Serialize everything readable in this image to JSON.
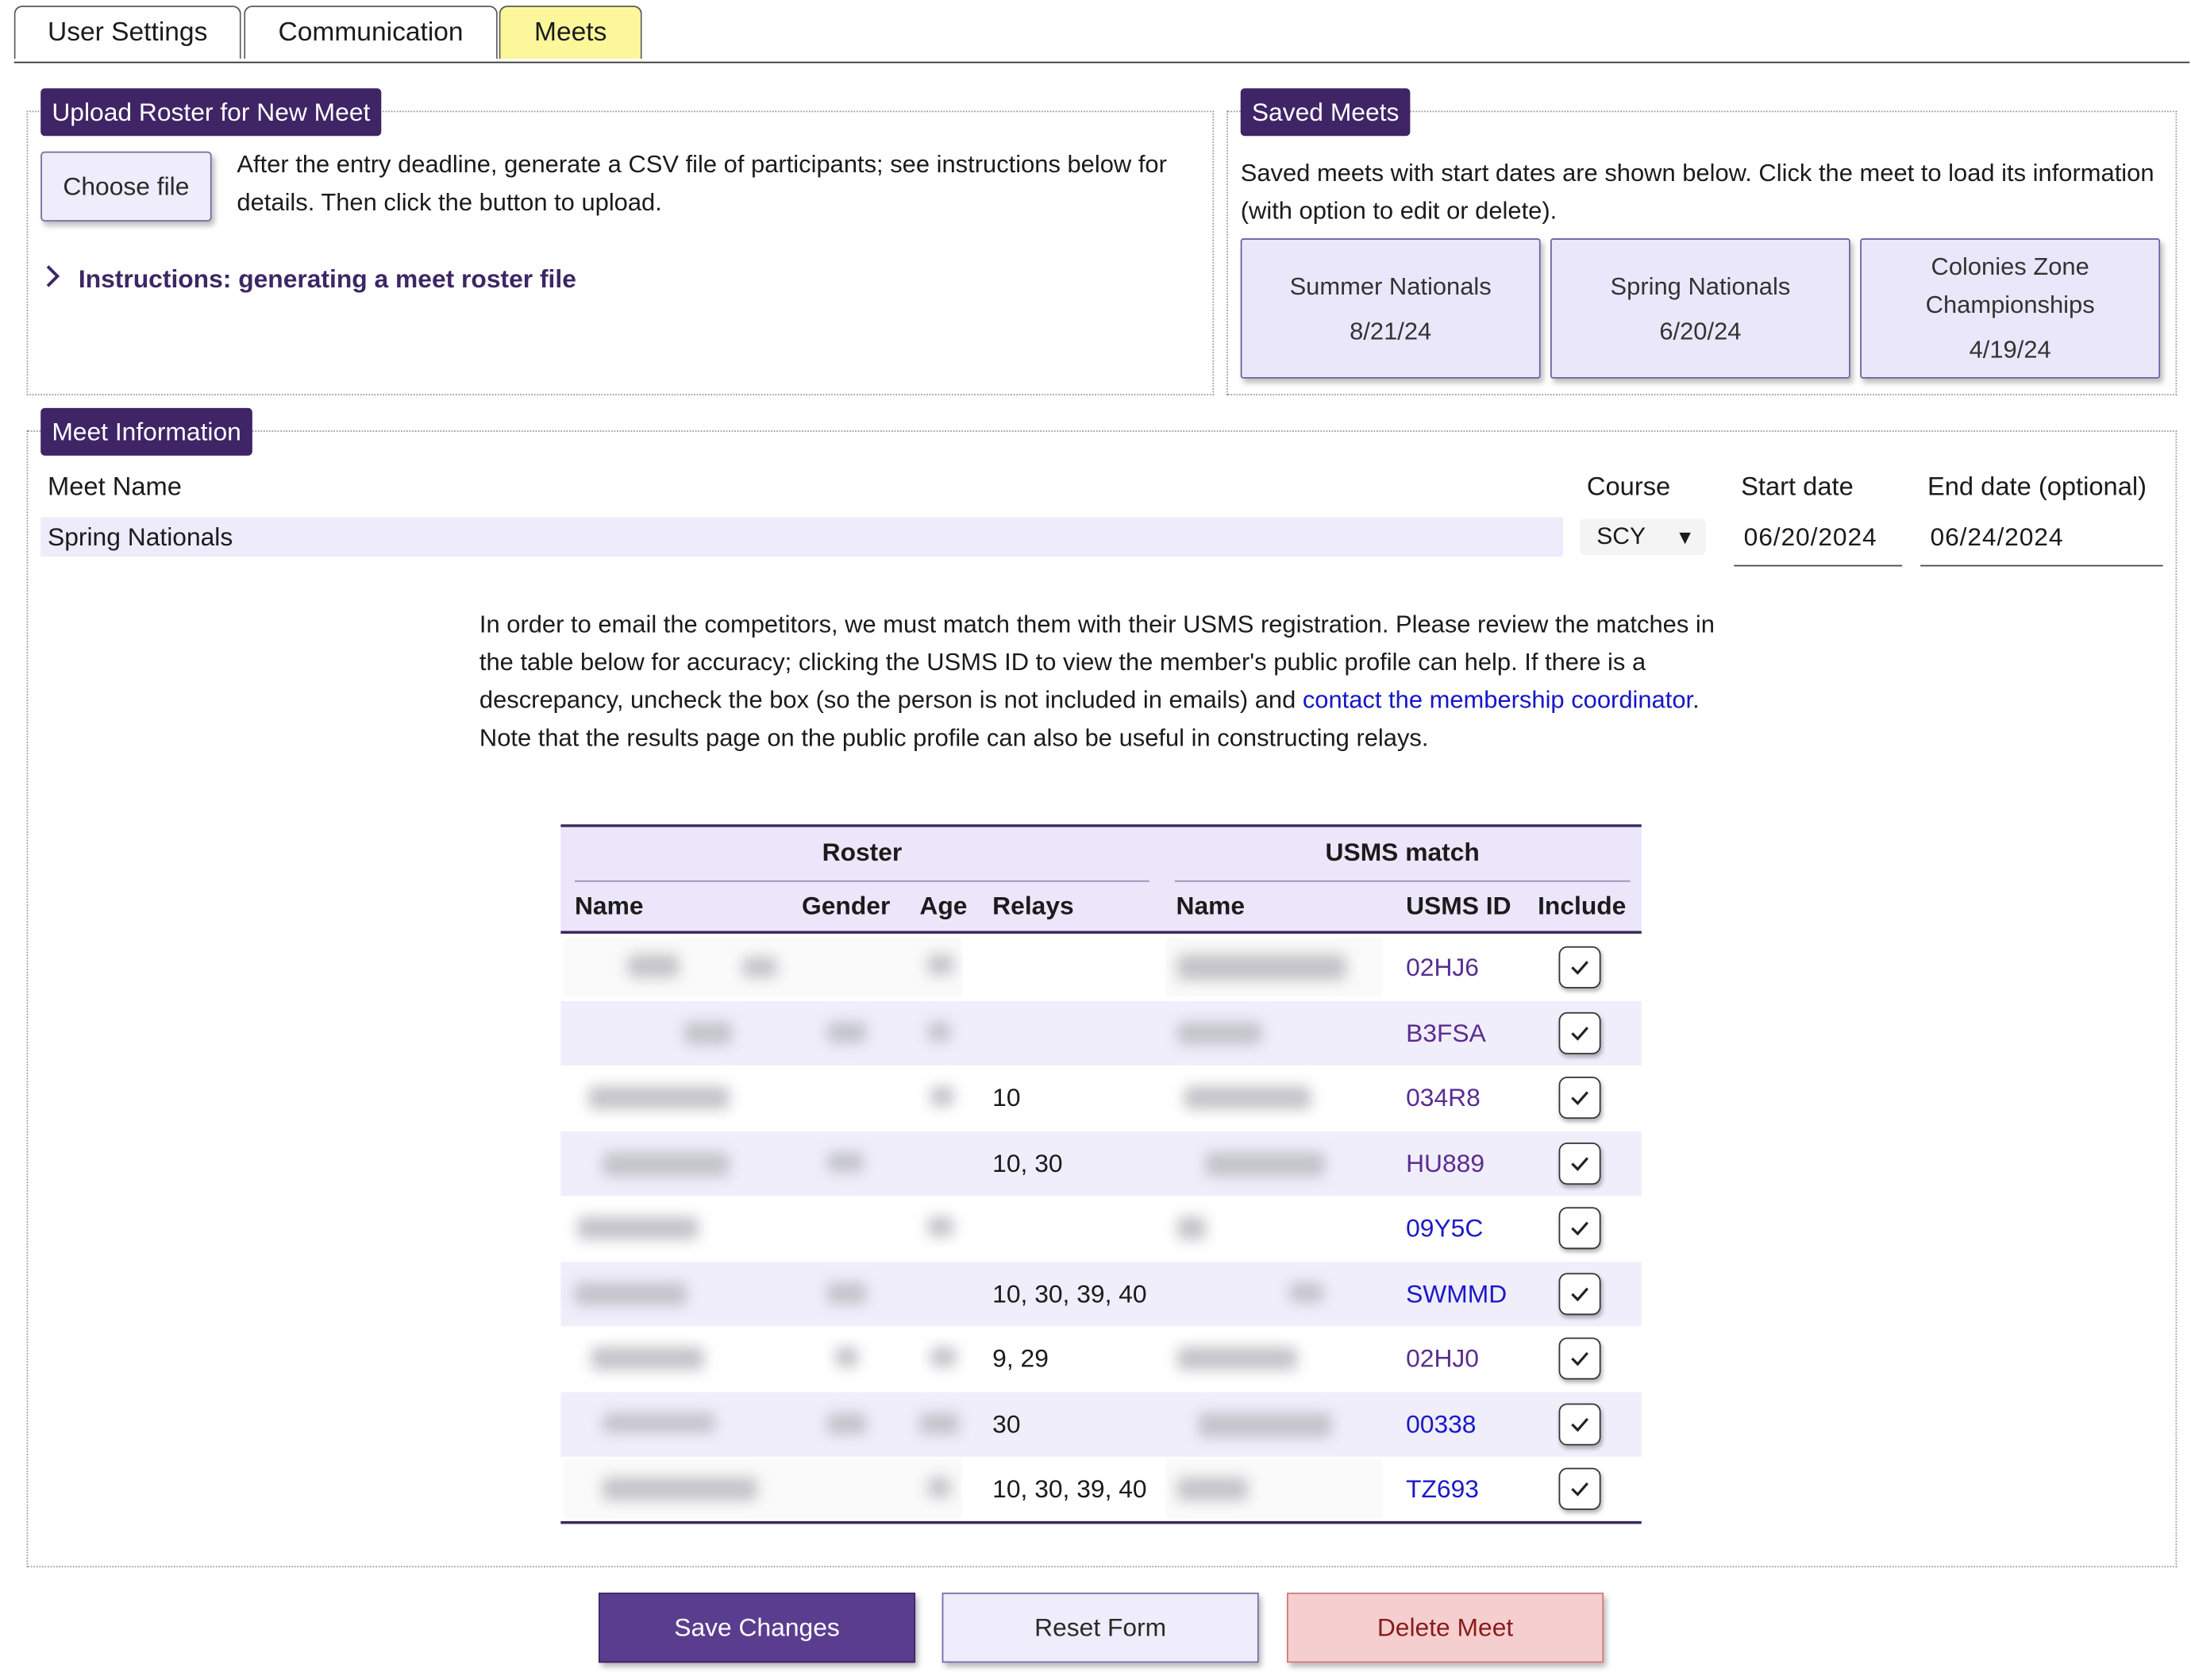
{
  "tabs": [
    {
      "label": "User Settings"
    },
    {
      "label": "Communication"
    },
    {
      "label": "Meets"
    }
  ],
  "upload": {
    "legend": "Upload Roster for New Meet",
    "choose_label": "Choose file",
    "text": "After the entry deadline, generate a CSV file of participants; see instructions below for details. Then click the button to upload.",
    "instructions_label": "Instructions: generating a meet roster file"
  },
  "saved": {
    "legend": "Saved Meets",
    "text": "Saved meets with start dates are shown below. Click the meet to load its information (with option to edit or delete).",
    "meets": [
      {
        "name": "Summer Nationals",
        "date": "8/21/24"
      },
      {
        "name": "Spring Nationals",
        "date": "6/20/24"
      },
      {
        "name": "Colonies Zone Championships",
        "date": "4/19/24"
      }
    ]
  },
  "meet_info": {
    "legend": "Meet Information",
    "name_label": "Meet Name",
    "name_value": "Spring Nationals",
    "course_label": "Course",
    "course_value": "SCY",
    "start_label": "Start date",
    "start_value": "06/20/2024",
    "end_label": "End date (optional)",
    "end_value": "06/24/2024",
    "info_1": "In order to email the competitors, we must match them with their USMS registration. Please review the matches in the table below for accuracy; clicking the USMS ID to view the member's public profile can help. If there is a descrepancy, uncheck the box (so the person is not included in emails) and ",
    "info_link": "contact the membership coordinator",
    "info_2": ". Note that the results page on the public profile can also be useful in constructing relays."
  },
  "table": {
    "group_roster": "Roster",
    "group_usms": "USMS match",
    "headers": [
      "Name",
      "Gender",
      "Age",
      "Relays",
      "Name",
      "USMS ID",
      "Include"
    ],
    "rows": [
      {
        "relays": "",
        "usms_id": "02HJ6",
        "include": true
      },
      {
        "relays": "",
        "usms_id": "B3FSA",
        "include": true
      },
      {
        "relays": "10",
        "usms_id": "034R8",
        "include": true
      },
      {
        "relays": "10, 30",
        "usms_id": "HU889",
        "include": true
      },
      {
        "relays": "",
        "usms_id": "09Y5C",
        "include": true
      },
      {
        "relays": "10, 30, 39, 40",
        "usms_id": "SWMMD",
        "include": true
      },
      {
        "relays": "9, 29",
        "usms_id": "02HJ0",
        "include": true
      },
      {
        "relays": "30",
        "usms_id": "00338",
        "include": true
      },
      {
        "relays": "10, 30, 39, 40",
        "usms_id": "TZ693",
        "include": true
      }
    ]
  },
  "actions": {
    "save": "Save Changes",
    "reset": "Reset Form",
    "delete": "Delete Meet"
  },
  "colors": {
    "legend_bg": "#3f2466",
    "active_tab": "#fbf79a",
    "save_bg": "#5b3d8f",
    "delete_bg": "#f5cfcf",
    "link": "#1515c9",
    "visited_link": "#5a2d91"
  }
}
